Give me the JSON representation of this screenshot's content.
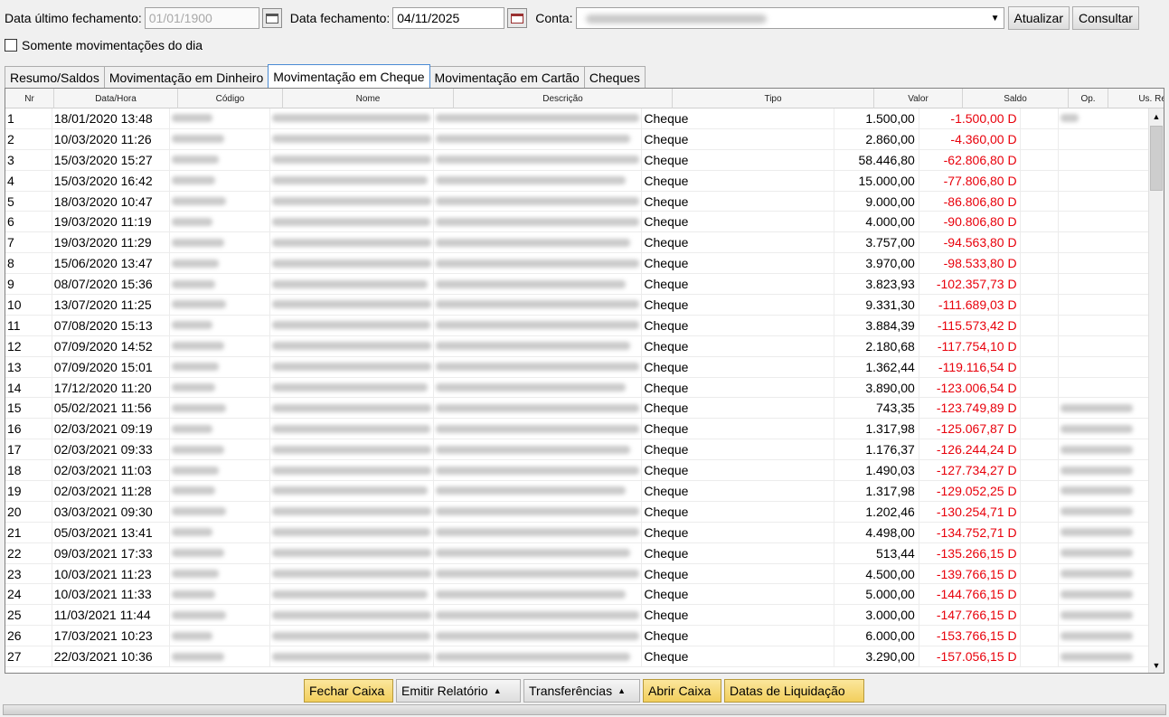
{
  "toolbar": {
    "ultimo_label": "Data último fechamento:",
    "ultimo_value": "01/01/1900",
    "fechamento_label": "Data fechamento:",
    "fechamento_value": "04/11/2025",
    "conta_label": "Conta:",
    "atualizar": "Atualizar",
    "consultar": "Consultar"
  },
  "somente_label": "Somente movimentações do dia",
  "tabs": [
    "Resumo/Saldos",
    "Movimentação em Dinheiro",
    "Movimentação em Cheque",
    "Movimentação em Cartão",
    "Cheques"
  ],
  "active_tab": 2,
  "columns": [
    "Nr",
    "Data/Hora",
    "Código",
    "Nome",
    "Descrição",
    "Tipo",
    "Valor",
    "Saldo",
    "Op.",
    "Us. Rec."
  ],
  "rows": [
    {
      "nr": "1",
      "datahora": "18/01/2020 13:48",
      "tipo": "Cheque",
      "valor": "1.500,00",
      "saldo": "-1.500,00 D"
    },
    {
      "nr": "2",
      "datahora": "10/03/2020 11:26",
      "tipo": "Cheque",
      "valor": "2.860,00",
      "saldo": "-4.360,00 D"
    },
    {
      "nr": "3",
      "datahora": "15/03/2020 15:27",
      "tipo": "Cheque",
      "valor": "58.446,80",
      "saldo": "-62.806,80 D"
    },
    {
      "nr": "4",
      "datahora": "15/03/2020 16:42",
      "tipo": "Cheque",
      "valor": "15.000,00",
      "saldo": "-77.806,80 D"
    },
    {
      "nr": "5",
      "datahora": "18/03/2020 10:47",
      "tipo": "Cheque",
      "valor": "9.000,00",
      "saldo": "-86.806,80 D"
    },
    {
      "nr": "6",
      "datahora": "19/03/2020 11:19",
      "tipo": "Cheque",
      "valor": "4.000,00",
      "saldo": "-90.806,80 D"
    },
    {
      "nr": "7",
      "datahora": "19/03/2020 11:29",
      "tipo": "Cheque",
      "valor": "3.757,00",
      "saldo": "-94.563,80 D"
    },
    {
      "nr": "8",
      "datahora": "15/06/2020 13:47",
      "tipo": "Cheque",
      "valor": "3.970,00",
      "saldo": "-98.533,80 D"
    },
    {
      "nr": "9",
      "datahora": "08/07/2020 15:36",
      "tipo": "Cheque",
      "valor": "3.823,93",
      "saldo": "-102.357,73 D"
    },
    {
      "nr": "10",
      "datahora": "13/07/2020 11:25",
      "tipo": "Cheque",
      "valor": "9.331,30",
      "saldo": "-111.689,03 D"
    },
    {
      "nr": "11",
      "datahora": "07/08/2020 15:13",
      "tipo": "Cheque",
      "valor": "3.884,39",
      "saldo": "-115.573,42 D"
    },
    {
      "nr": "12",
      "datahora": "07/09/2020 14:52",
      "tipo": "Cheque",
      "valor": "2.180,68",
      "saldo": "-117.754,10 D"
    },
    {
      "nr": "13",
      "datahora": "07/09/2020 15:01",
      "tipo": "Cheque",
      "valor": "1.362,44",
      "saldo": "-119.116,54 D"
    },
    {
      "nr": "14",
      "datahora": "17/12/2020 11:20",
      "tipo": "Cheque",
      "valor": "3.890,00",
      "saldo": "-123.006,54 D"
    },
    {
      "nr": "15",
      "datahora": "05/02/2021 11:56",
      "tipo": "Cheque",
      "valor": "743,35",
      "saldo": "-123.749,89 D"
    },
    {
      "nr": "16",
      "datahora": "02/03/2021 09:19",
      "tipo": "Cheque",
      "valor": "1.317,98",
      "saldo": "-125.067,87 D"
    },
    {
      "nr": "17",
      "datahora": "02/03/2021 09:33",
      "tipo": "Cheque",
      "valor": "1.176,37",
      "saldo": "-126.244,24 D"
    },
    {
      "nr": "18",
      "datahora": "02/03/2021 11:03",
      "tipo": "Cheque",
      "valor": "1.490,03",
      "saldo": "-127.734,27 D"
    },
    {
      "nr": "19",
      "datahora": "02/03/2021 11:28",
      "tipo": "Cheque",
      "valor": "1.317,98",
      "saldo": "-129.052,25 D"
    },
    {
      "nr": "20",
      "datahora": "03/03/2021 09:30",
      "tipo": "Cheque",
      "valor": "1.202,46",
      "saldo": "-130.254,71 D"
    },
    {
      "nr": "21",
      "datahora": "05/03/2021 13:41",
      "tipo": "Cheque",
      "valor": "4.498,00",
      "saldo": "-134.752,71 D"
    },
    {
      "nr": "22",
      "datahora": "09/03/2021 17:33",
      "tipo": "Cheque",
      "valor": "513,44",
      "saldo": "-135.266,15 D"
    },
    {
      "nr": "23",
      "datahora": "10/03/2021 11:23",
      "tipo": "Cheque",
      "valor": "4.500,00",
      "saldo": "-139.766,15 D"
    },
    {
      "nr": "24",
      "datahora": "10/03/2021 11:33",
      "tipo": "Cheque",
      "valor": "5.000,00",
      "saldo": "-144.766,15 D"
    },
    {
      "nr": "25",
      "datahora": "11/03/2021 11:44",
      "tipo": "Cheque",
      "valor": "3.000,00",
      "saldo": "-147.766,15 D"
    },
    {
      "nr": "26",
      "datahora": "17/03/2021 10:23",
      "tipo": "Cheque",
      "valor": "6.000,00",
      "saldo": "-153.766,15 D"
    },
    {
      "nr": "27",
      "datahora": "22/03/2021 10:36",
      "tipo": "Cheque",
      "valor": "3.290,00",
      "saldo": "-157.056,15 D"
    }
  ],
  "buttons": {
    "fechar_caixa": "Fechar Caixa",
    "emitir_relatorio": "Emitir Relatório",
    "transferencias": "Transferências",
    "abrir_caixa": "Abrir Caixa",
    "datas_liquidacao": "Datas de Liquidação"
  },
  "colors": {
    "negative": "#e8000b",
    "tab_active_border": "#4a8bd4",
    "button_highlight": "#f2cf5c"
  },
  "icons": {
    "calendar": "calendar-icon",
    "dropdown": "chevron-down-icon",
    "menu_up": "caret-up-icon"
  }
}
